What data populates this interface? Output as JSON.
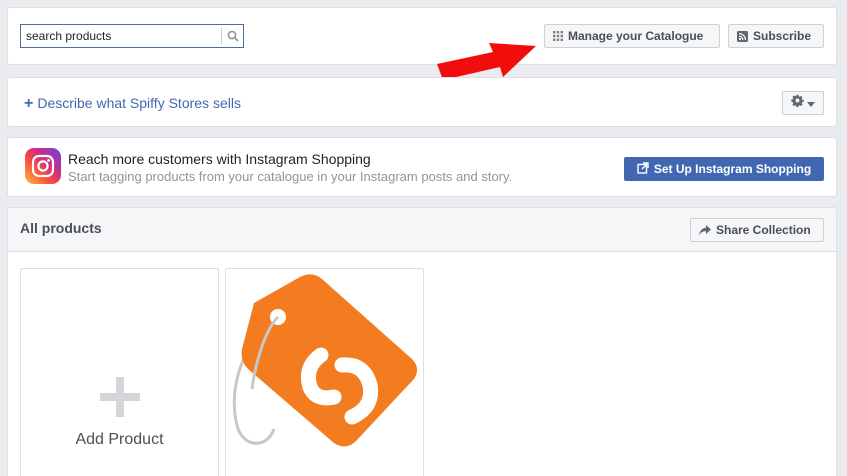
{
  "search": {
    "placeholder": "search products"
  },
  "toolbar": {
    "manage_label": "Manage your Catalogue",
    "subscribe_label": "Subscribe"
  },
  "describe": {
    "link_text": "Describe what Spiffy Stores sells"
  },
  "instagram": {
    "title": "Reach more customers with Instagram Shopping",
    "subtitle": "Start tagging products from your catalogue in your Instagram posts and story.",
    "button_label": "Set Up Instagram Shopping"
  },
  "products": {
    "title": "All products",
    "share_label": "Share Collection",
    "add_label": "Add Product"
  },
  "colors": {
    "accent": "#4267b2",
    "annotation_arrow": "#f20d0d",
    "product_tag": "#f47c20"
  },
  "icons": [
    "search-icon",
    "grid-icon",
    "rss-icon",
    "gear-icon",
    "chevron-down-icon",
    "instagram-icon",
    "external-link-icon",
    "share-icon",
    "plus-icon"
  ]
}
